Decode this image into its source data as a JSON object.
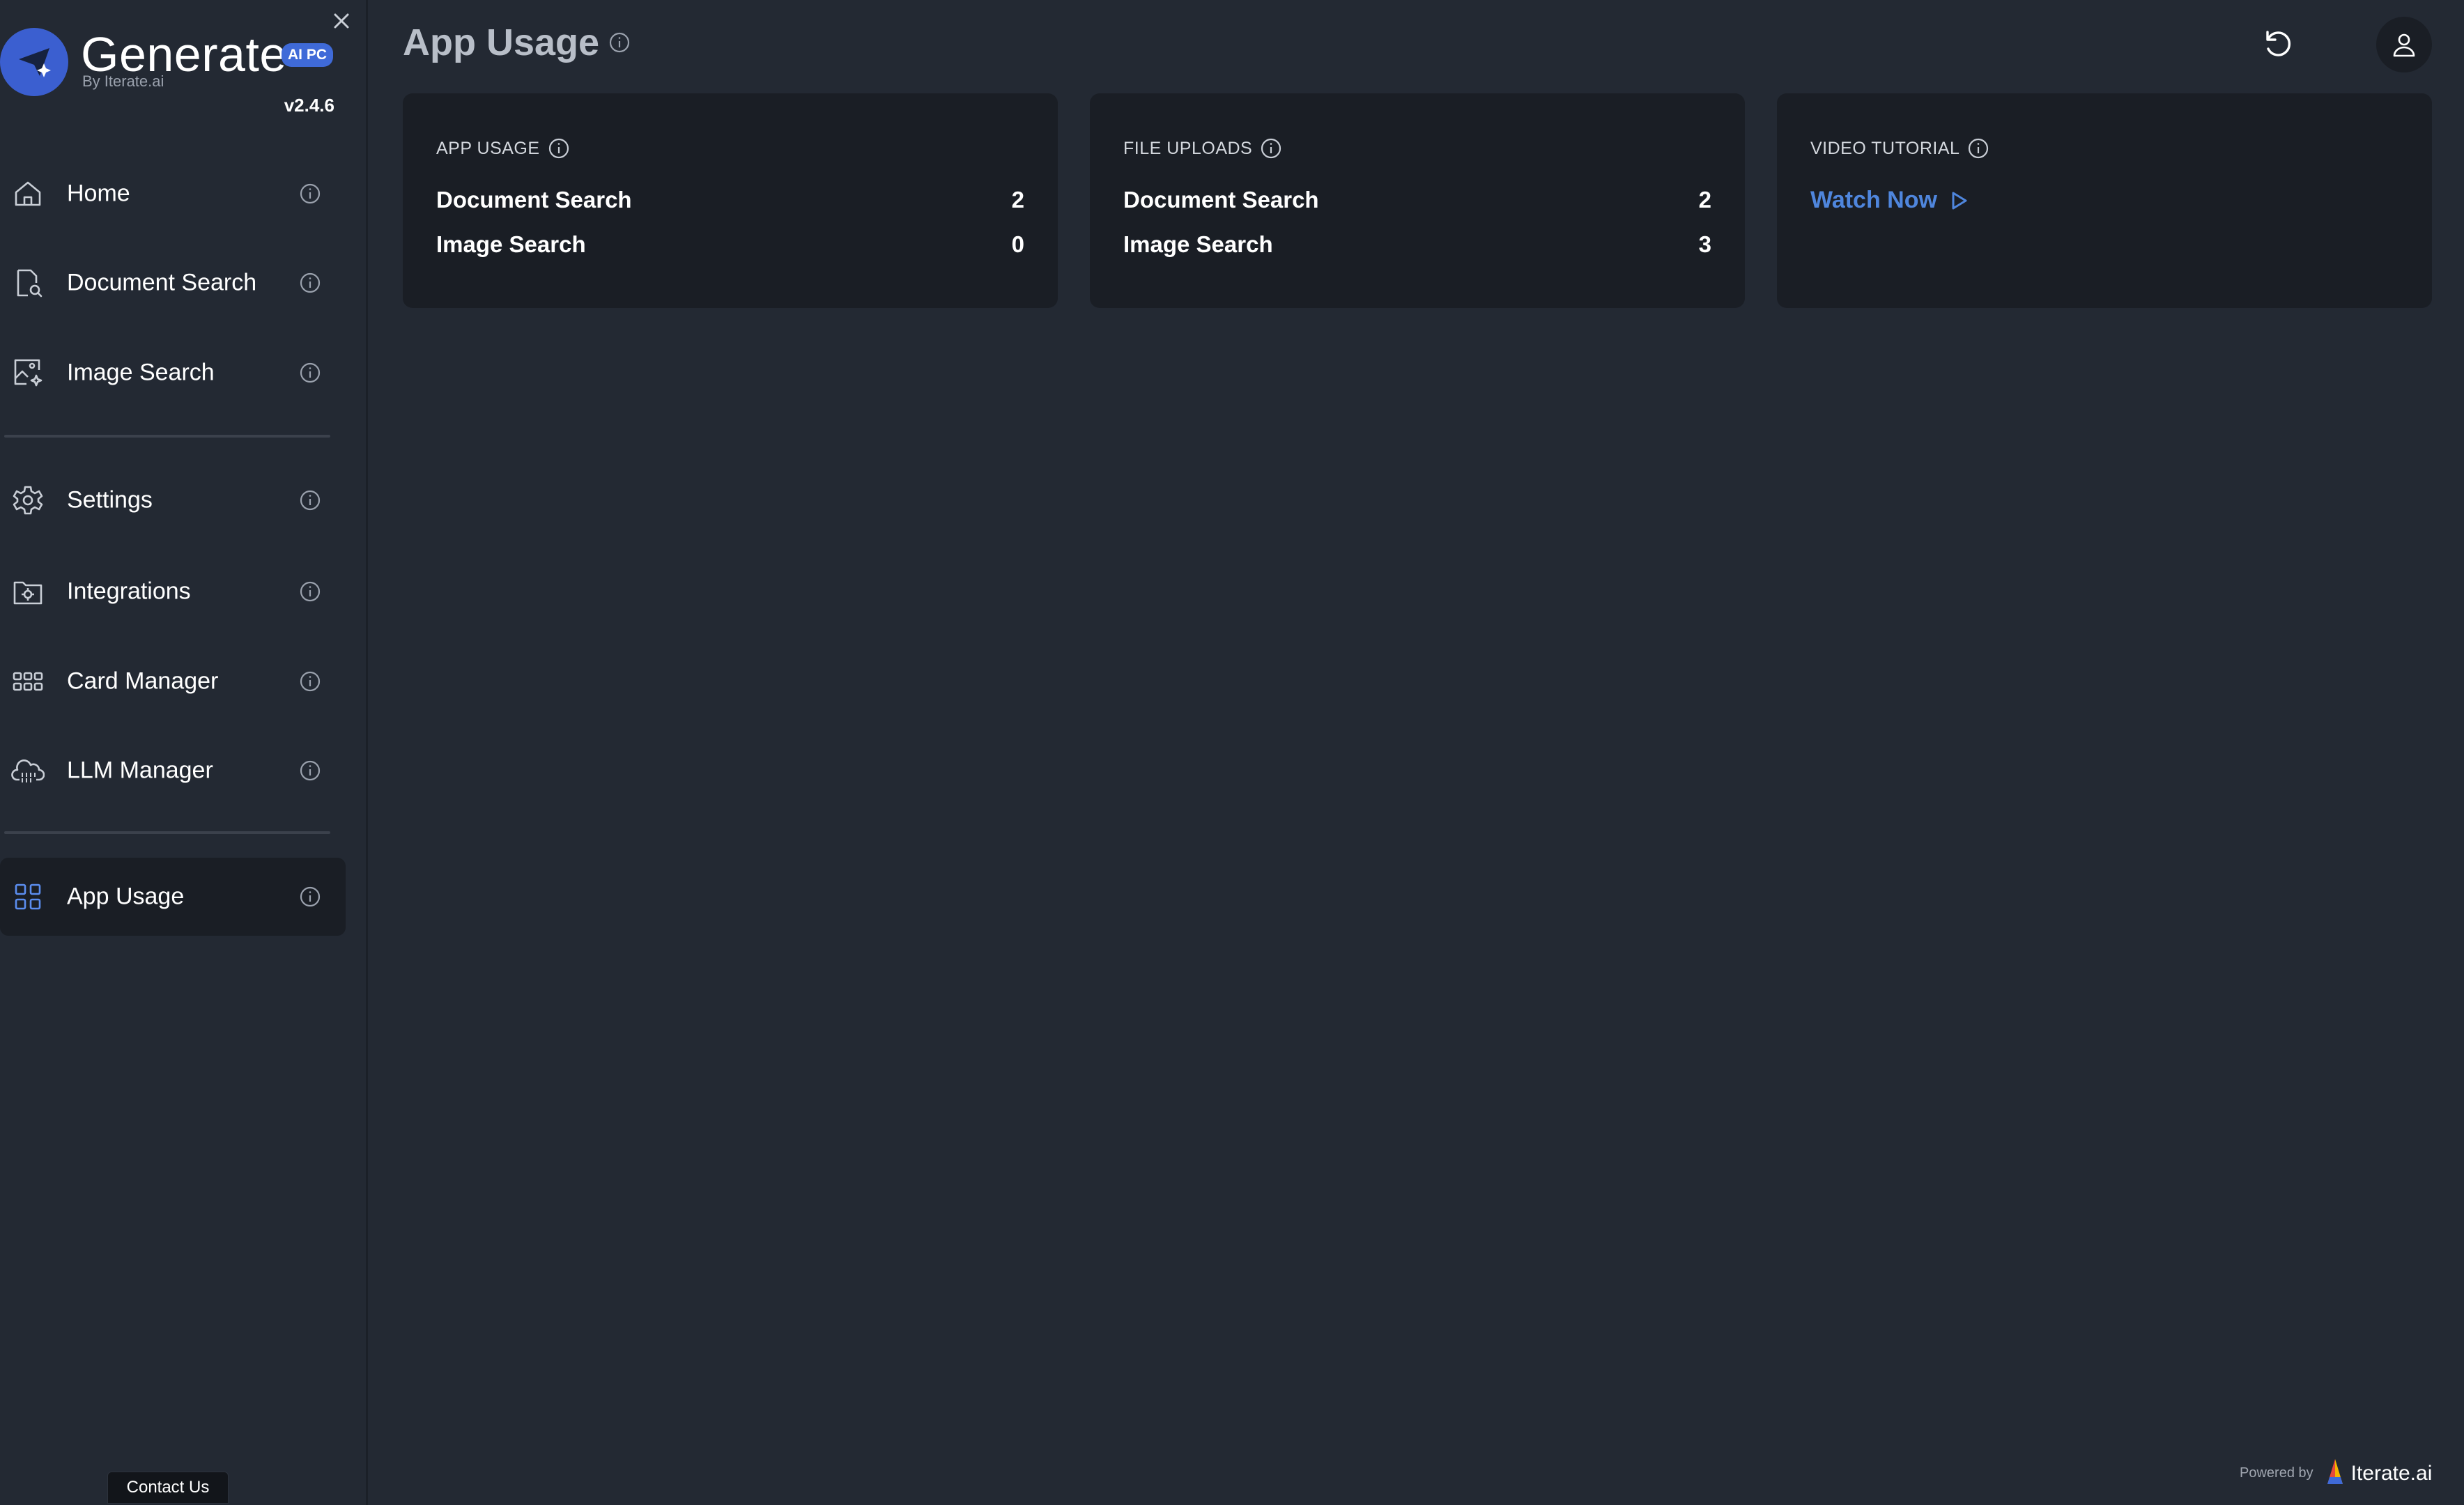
{
  "brand": {
    "name": "Generate",
    "badge": "AI PC",
    "by_line": "By Iterate.ai",
    "version": "v2.4.6"
  },
  "sidebar": {
    "items": [
      {
        "label": "Home",
        "icon": "home-icon"
      },
      {
        "label": "Document Search",
        "icon": "document-search-icon"
      },
      {
        "label": "Image Search",
        "icon": "image-search-icon"
      },
      {
        "label": "Settings",
        "icon": "gear-icon"
      },
      {
        "label": "Integrations",
        "icon": "integrations-icon"
      },
      {
        "label": "Card Manager",
        "icon": "grid-icon"
      },
      {
        "label": "LLM Manager",
        "icon": "cloud-icon"
      },
      {
        "label": "App Usage",
        "icon": "dashboard-icon",
        "active": true
      }
    ],
    "contact_label": "Contact Us"
  },
  "header": {
    "title": "App Usage"
  },
  "cards": {
    "app_usage": {
      "heading": "APP USAGE",
      "rows": [
        {
          "label": "Document Search",
          "value": "2"
        },
        {
          "label": "Image Search",
          "value": "0"
        }
      ]
    },
    "file_uploads": {
      "heading": "FILE UPLOADS",
      "rows": [
        {
          "label": "Document Search",
          "value": "2"
        },
        {
          "label": "Image Search",
          "value": "3"
        }
      ]
    },
    "video_tutorial": {
      "heading": "VIDEO TUTORIAL",
      "link_label": "Watch Now"
    }
  },
  "footer": {
    "powered_label": "Powered by",
    "powered_brand": "Iterate.ai"
  },
  "colors": {
    "background": "#232933",
    "card": "#1a1e25",
    "accent": "#3f6ad8",
    "link": "#4f86dd"
  }
}
